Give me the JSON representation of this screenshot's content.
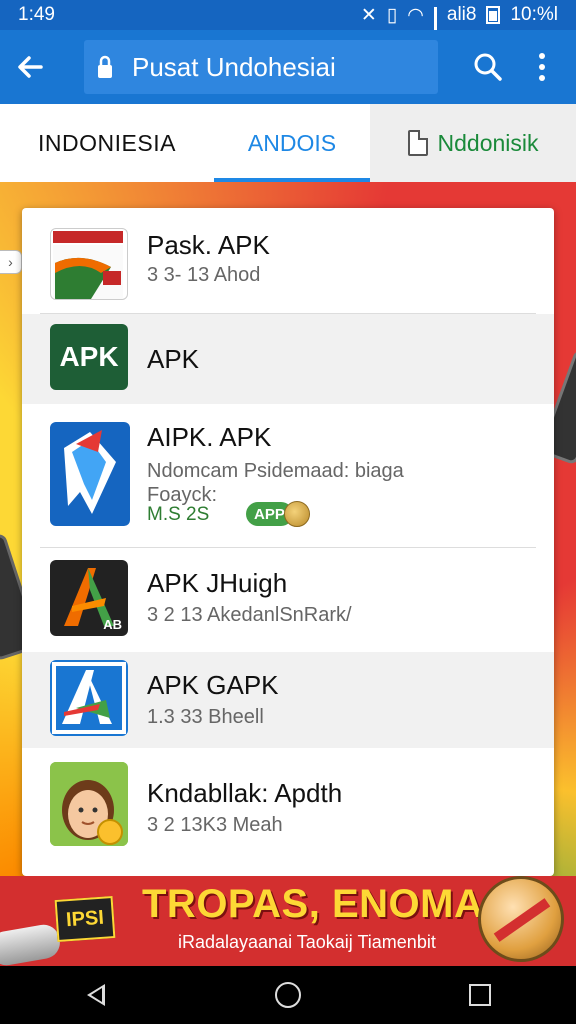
{
  "status_bar": {
    "time": "1:49",
    "carrier": "ali8",
    "clock_right": "10:%l"
  },
  "app_bar": {
    "url": "Pusat Undohesiai"
  },
  "tabs": [
    {
      "label": "INDONIESIA"
    },
    {
      "label": "ANDOIS"
    },
    {
      "label": "Nddonisik"
    }
  ],
  "apps": [
    {
      "title": "Pask. APK",
      "sub": "3 3- 13 Ahod"
    },
    {
      "title": "APK",
      "icon_text": "APK"
    },
    {
      "title": "AIPK. APK",
      "sub": "Ndomcam Psidemaad: biaga",
      "sub2": "Foayck:",
      "meta": "M.S 2S",
      "badge": "APP"
    },
    {
      "title": "APK JHuigh",
      "sub": "3 2 13 AkedanlSnRark/",
      "icon_text": "AB"
    },
    {
      "title": "APK GAPK",
      "sub": "1.3 33 Bheell"
    },
    {
      "title": "Kndabllak: Apdth",
      "sub": "3 2 13K3 Meah"
    }
  ],
  "banner": {
    "badge": "IPSI",
    "title": "TROPAS, ENOMA",
    "subtitle": "iRadalayaanai Taokaij Tiamenbit"
  },
  "colors": {
    "appbar": "#1976d2",
    "status": "#1565c0",
    "accent": "#1e88e5",
    "green": "#43a047",
    "banner": "#d32f2f"
  }
}
